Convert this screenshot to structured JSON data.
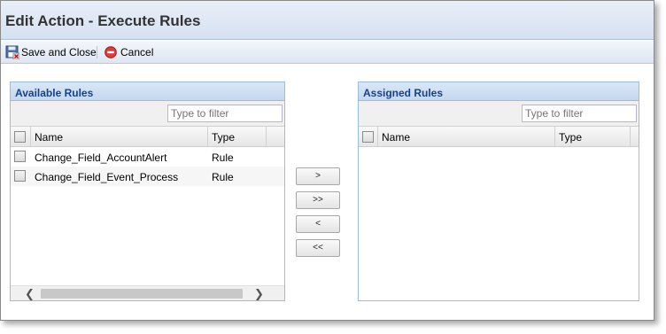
{
  "window": {
    "title": "Edit Action - Execute Rules"
  },
  "toolbar": {
    "save_label": "Save and Close",
    "cancel_label": "Cancel"
  },
  "available": {
    "header": "Available Rules",
    "filter_placeholder": "Type to filter",
    "columns": {
      "name": "Name",
      "type": "Type"
    },
    "rows": [
      {
        "name": "Change_Field_AccountAlert",
        "type": "Rule"
      },
      {
        "name": "Change_Field_Event_Process",
        "type": "Rule"
      }
    ]
  },
  "assigned": {
    "header": "Assigned Rules",
    "filter_placeholder": "Type to filter",
    "columns": {
      "name": "Name",
      "type": "Type"
    }
  },
  "move_buttons": {
    "add": ">",
    "add_all": ">>",
    "remove": "<",
    "remove_all": "<<"
  },
  "scroll": {
    "left": "❮",
    "right": "❯"
  }
}
